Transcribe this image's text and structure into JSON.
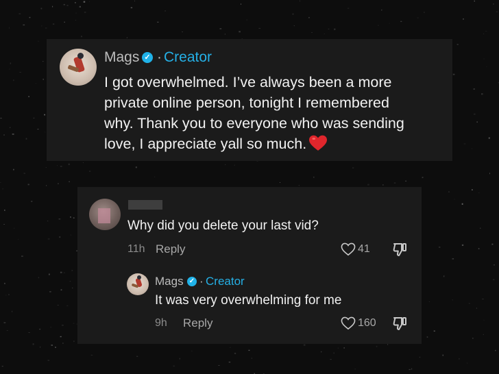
{
  "post": {
    "author": "Mags",
    "badge": "Creator",
    "separator": "·",
    "lines": [
      "I got overwhelmed. I’ve always been a more",
      "private online person, tonight I remembered",
      "why. Thank you to everyone who was sending",
      "love, I appreciate yall so much."
    ]
  },
  "comment": {
    "text": "Why did you delete your last vid?",
    "time": "11h",
    "reply_label": "Reply",
    "likes": "41"
  },
  "reply": {
    "author": "Mags",
    "badge": "Creator",
    "separator": "·",
    "text": "It was very overwhelming for me",
    "time": "9h",
    "reply_label": "Reply",
    "likes": "160"
  },
  "icons": {
    "verified": "verified-check-icon",
    "heart_emoji": "red-heart-emoji",
    "like": "heart-outline-icon",
    "dislike": "thumbs-down-icon"
  },
  "colors": {
    "accent": "#25b0e6",
    "card": "#1b1b1b",
    "heart": "#e0262c"
  }
}
